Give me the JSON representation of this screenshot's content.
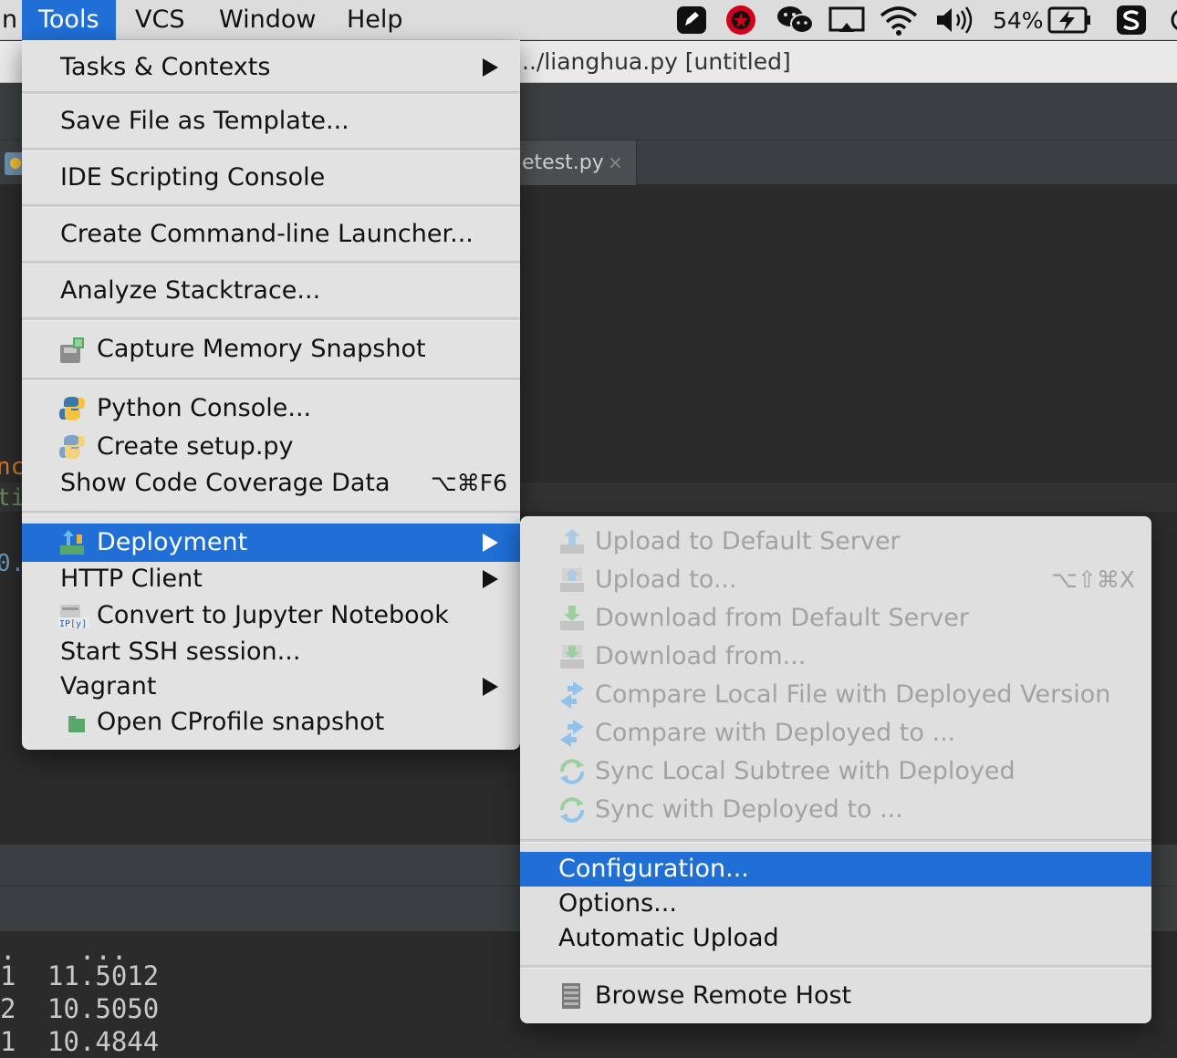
{
  "menubar": {
    "partial_left": "n",
    "items": [
      "Tools",
      "VCS",
      "Window",
      "Help"
    ],
    "battery_percent": "54%",
    "status_icons": [
      "pencil-app-icon",
      "record-icon",
      "wechat-icon",
      "airplay-icon",
      "wifi-icon",
      "volume-icon",
      "battery-charging-icon",
      "s-app-icon"
    ]
  },
  "window": {
    "title": "../lianghua.py [untitled]",
    "tab_label": "etest.py",
    "tab_close": "×"
  },
  "editor": {
    "frag1": "nc",
    "frag2": "ti",
    "frag3": "0."
  },
  "console": {
    "rows": [
      {
        "idx": ".",
        "val": "  ..."
      },
      {
        "idx": "1",
        "val": "11.5012"
      },
      {
        "idx": "2",
        "val": "10.5050"
      },
      {
        "idx": "1",
        "val": "10.4844"
      }
    ]
  },
  "tools_menu": {
    "tasks_contexts": "Tasks & Contexts",
    "save_template": "Save File as Template...",
    "ide_scripting": "IDE Scripting Console",
    "cmd_launcher": "Create Command-line Launcher...",
    "analyze_stack": "Analyze Stacktrace...",
    "capture_memory": "Capture Memory Snapshot",
    "python_console": "Python Console...",
    "create_setup": "Create setup.py",
    "show_coverage": "Show Code Coverage Data",
    "show_coverage_shortcut": "⌥⌘F6",
    "deployment": "Deployment",
    "http_client": "HTTP Client",
    "convert_jupyter": "Convert to Jupyter Notebook",
    "start_ssh": "Start SSH session...",
    "vagrant": "Vagrant",
    "open_cprofile": "Open CProfile snapshot"
  },
  "deployment_menu": {
    "upload_default": "Upload to Default Server",
    "upload_to": "Upload to...",
    "upload_to_shortcut": "⌥⇧⌘X",
    "download_default": "Download from Default Server",
    "download_from": "Download from...",
    "compare_local": "Compare Local File with Deployed Version",
    "compare_with": "Compare with Deployed to ...",
    "sync_subtree": "Sync Local Subtree with Deployed",
    "sync_with": "Sync with Deployed to ...",
    "configuration": "Configuration...",
    "options": "Options...",
    "automatic_upload": "Automatic Upload",
    "browse_remote": "Browse Remote Host"
  },
  "colors": {
    "highlight": "#1f6fd6",
    "menu_bg": "#e2e2e2",
    "disabled_text": "#a2a2a2",
    "editor_bg": "#2b2b2b"
  }
}
